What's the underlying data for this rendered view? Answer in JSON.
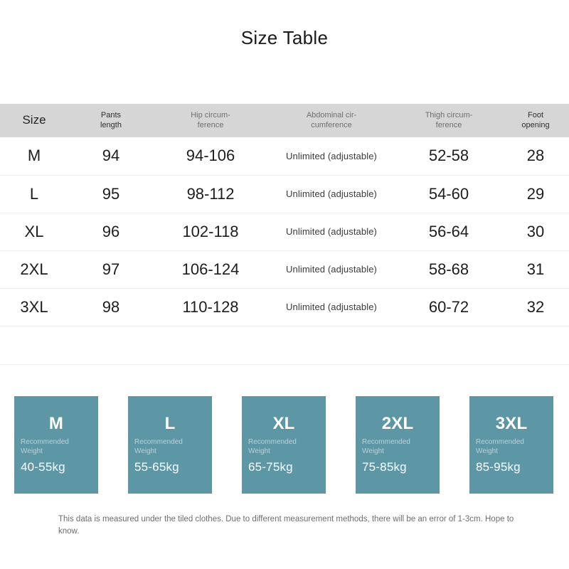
{
  "title": "Size Table",
  "table": {
    "headers": [
      {
        "key": "size",
        "label": "Size"
      },
      {
        "key": "pants",
        "label": "Pants\nlength"
      },
      {
        "key": "hip",
        "label": "Hip circum-\nference"
      },
      {
        "key": "abdominal",
        "label": "Abdominal cir-\ncumference"
      },
      {
        "key": "thigh",
        "label": "Thigh circum-\nference"
      },
      {
        "key": "foot",
        "label": "Foot\nopening"
      }
    ],
    "rows": [
      {
        "size": "M",
        "pants": "94",
        "hip": "94-106",
        "abdominal": "Unlimited (adjustable)",
        "thigh": "52-58",
        "foot": "28"
      },
      {
        "size": "L",
        "pants": "95",
        "hip": "98-112",
        "abdominal": "Unlimited (adjustable)",
        "thigh": "54-60",
        "foot": "29"
      },
      {
        "size": "XL",
        "pants": "96",
        "hip": "102-118",
        "abdominal": "Unlimited (adjustable)",
        "thigh": "56-64",
        "foot": "30"
      },
      {
        "size": "2XL",
        "pants": "97",
        "hip": "106-124",
        "abdominal": "Unlimited (adjustable)",
        "thigh": "58-68",
        "foot": "31"
      },
      {
        "size": "3XL",
        "pants": "98",
        "hip": "110-128",
        "abdominal": "Unlimited (adjustable)",
        "thigh": "60-72",
        "foot": "32"
      }
    ]
  },
  "cards": [
    {
      "size": "M",
      "rec_label": "Recommended\nWeight",
      "weight": "40-55kg"
    },
    {
      "size": "L",
      "rec_label": "Recommended\nWeight",
      "weight": "55-65kg"
    },
    {
      "size": "XL",
      "rec_label": "Recommended\nWeight",
      "weight": "65-75kg"
    },
    {
      "size": "2XL",
      "rec_label": "Recommended\nWeight",
      "weight": "75-85kg"
    },
    {
      "size": "3XL",
      "rec_label": "Recommended\nWeight",
      "weight": "85-95kg"
    }
  ],
  "note": "This data is measured under the tiled clothes. Due to different measurement methods, there will be an error of 1-3cm. Hope to know.",
  "colors": {
    "card_teal": "#5d97a5",
    "header_gray": "#d6d6d6",
    "row_divider": "#ededed",
    "text_dark": "#1d1d1d",
    "text_muted": "#6f6f6f"
  }
}
